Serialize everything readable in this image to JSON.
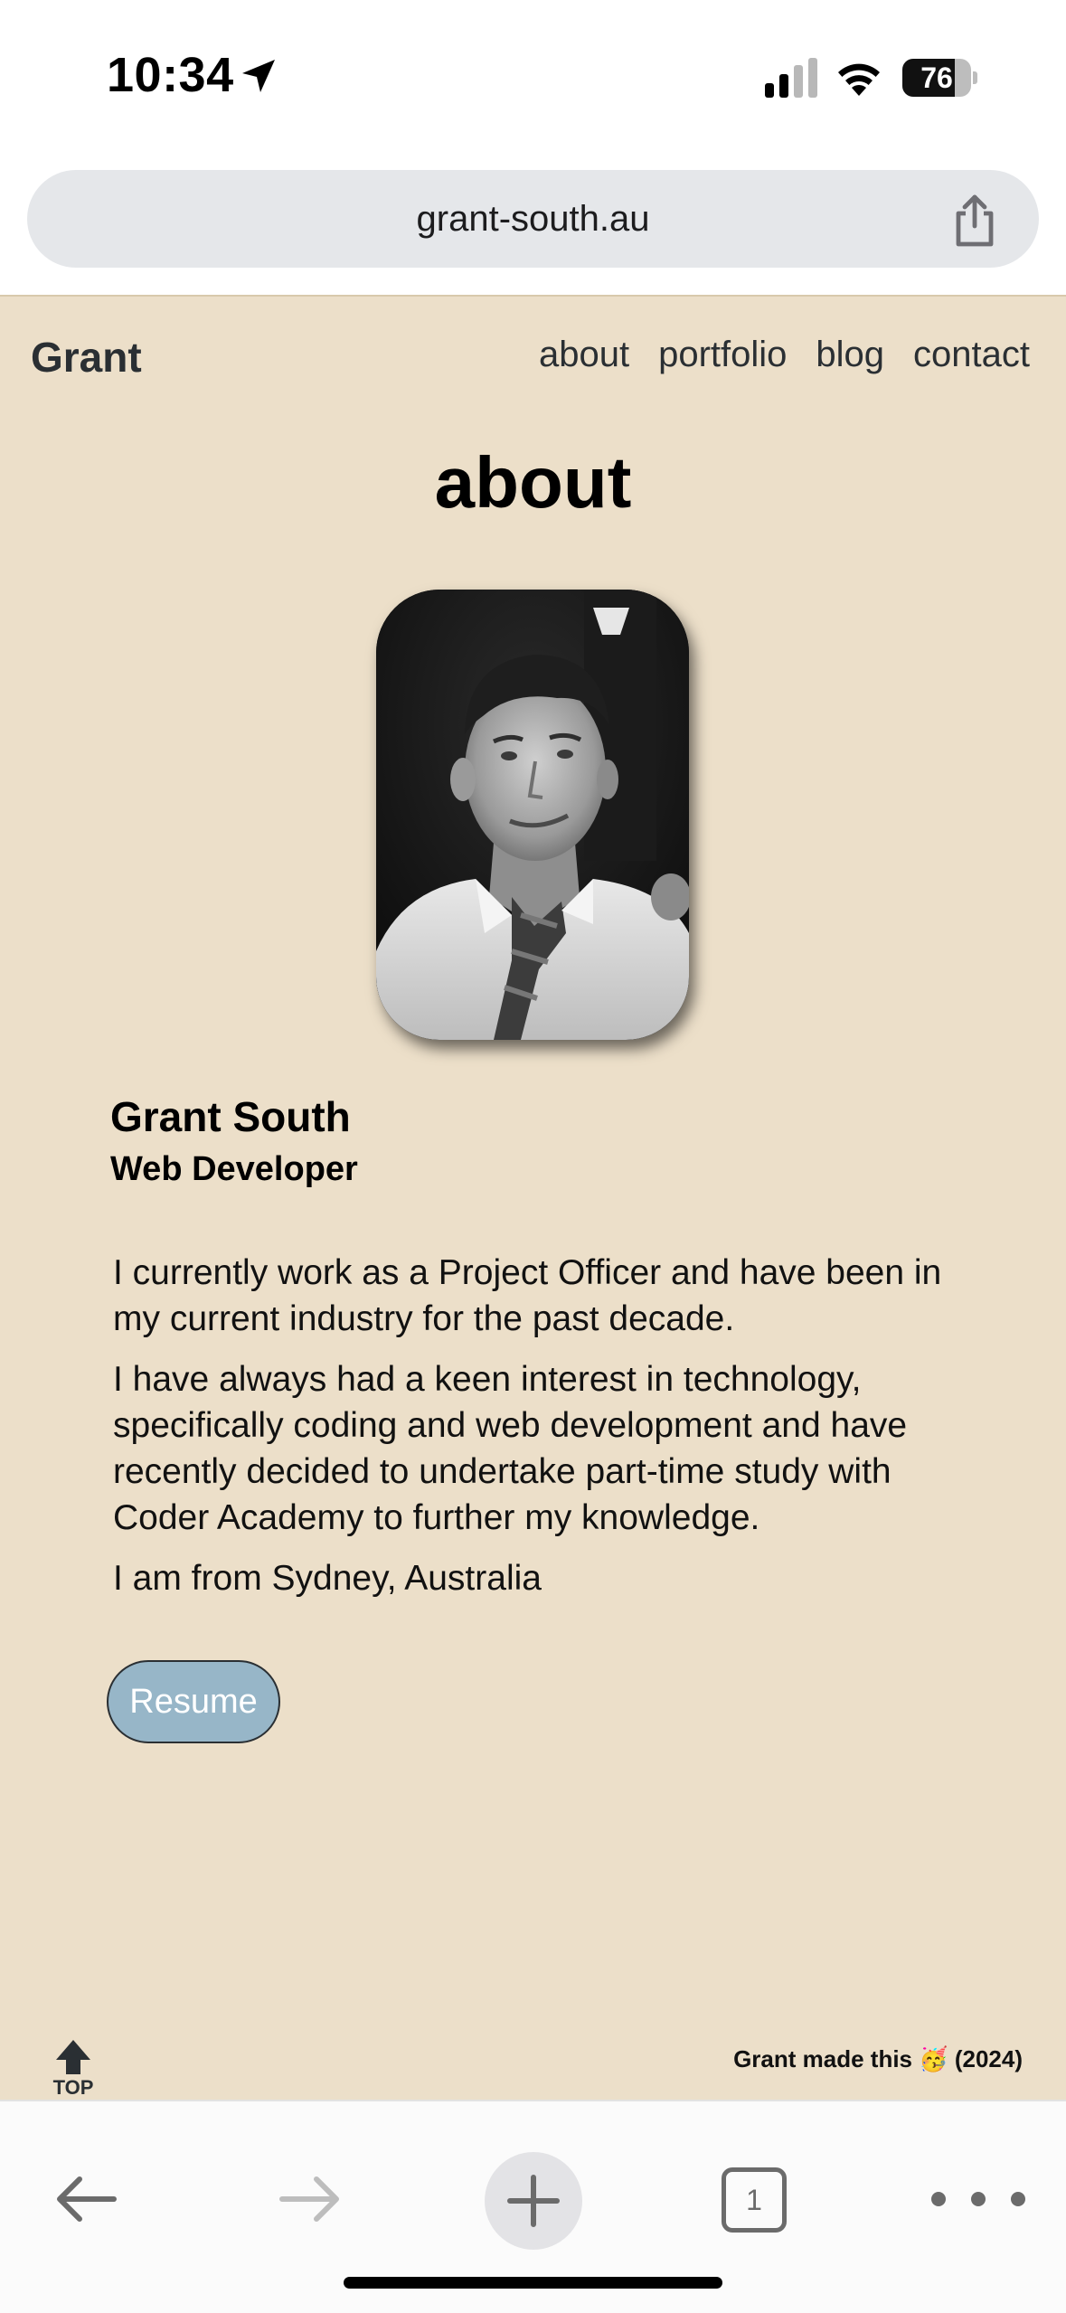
{
  "status_bar": {
    "time": "10:34",
    "battery": "76",
    "battery_level": 0.76
  },
  "browser": {
    "url": "grant-south.au",
    "tab_count": "1"
  },
  "header": {
    "brand": "Grant",
    "nav": [
      "about",
      "portfolio",
      "blog",
      "contact"
    ]
  },
  "main": {
    "heading": "about",
    "name": "Grant South",
    "role": "Web Developer",
    "bio": [
      "I currently work as a Project Officer and have been in my current industry for the past decade.",
      "I have always had a keen interest in technology, specifically coding and web development and have recently decided to undertake part-time study with Coder Academy to further my knowledge.",
      "I am from Sydney, Australia"
    ],
    "resume_label": "Resume"
  },
  "footer": {
    "top_label": "TOP",
    "note": "Grant made this 🥳 (2024)"
  },
  "colors": {
    "page_bg": "#ecdfc9",
    "resume_bg": "#97b6c8",
    "brand_text": "#2a2f33"
  }
}
